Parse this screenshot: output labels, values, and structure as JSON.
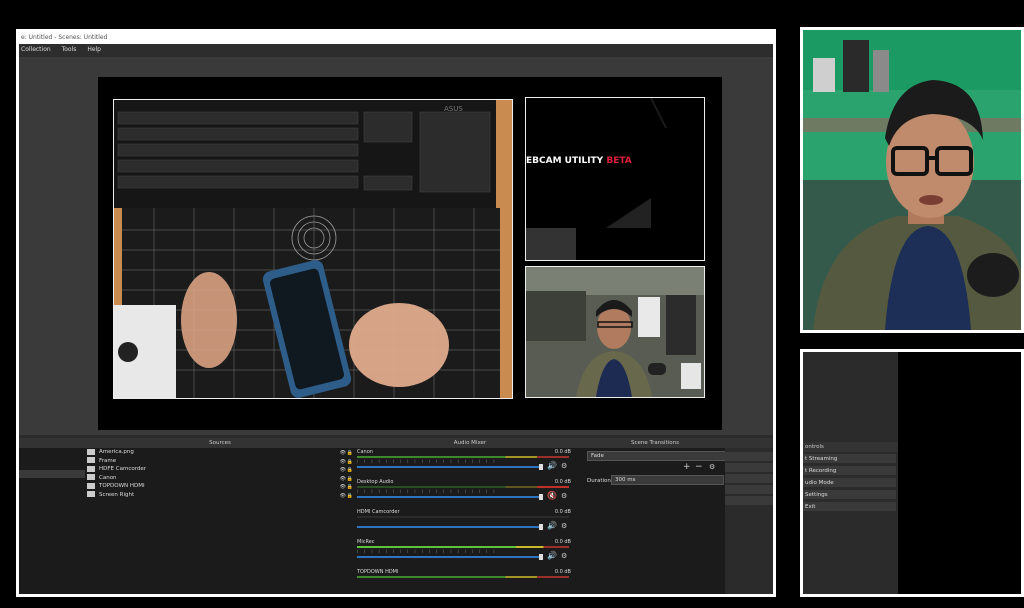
{
  "window": {
    "title": "e: Untitled - Scenes: Untitled"
  },
  "menu": [
    "Collection",
    "Tools",
    "Help"
  ],
  "preview": {
    "logo_text_white": "EBCAM UTILITY ",
    "logo_text_accent": "BETA",
    "keyboard_brand": "ASUS"
  },
  "docks": {
    "sources_title": "Sources",
    "audio_title": "Audio Mixer",
    "transitions_title": "Scene Transitions",
    "controls_title": "ontrols"
  },
  "sources": [
    {
      "name": "America.png"
    },
    {
      "name": "Frame"
    },
    {
      "name": "HDFE Camcorder"
    },
    {
      "name": "Canon"
    },
    {
      "name": "TOPDOWN HDMI"
    },
    {
      "name": "Screen Right"
    }
  ],
  "audio_channels": [
    {
      "name": "Canon",
      "db": "0.0 dB",
      "muted": false
    },
    {
      "name": "Desktop Audio",
      "db": "0.0 dB",
      "muted": true
    },
    {
      "name": "HDMI Camcorder",
      "db": "0.0 dB",
      "muted": false
    },
    {
      "name": "MicRec",
      "db": "0.0 dB",
      "muted": false
    },
    {
      "name": "TOPDOWN HDMI",
      "db": "0.0 dB",
      "muted": false
    }
  ],
  "transitions": {
    "selected": "Fade",
    "duration_label": "Duration",
    "duration_value": "300 ms"
  },
  "controls": [
    {
      "label": "t Streaming"
    },
    {
      "label": "t Recording"
    },
    {
      "label": "udio Mode"
    },
    {
      "label": "Settings"
    },
    {
      "label": "Exit"
    }
  ],
  "colors": {
    "accent_red": "#e0203a",
    "fader_blue": "#2f74c0",
    "meter_green": "#3c8a2c",
    "facecam_green": "#2aa36e"
  }
}
